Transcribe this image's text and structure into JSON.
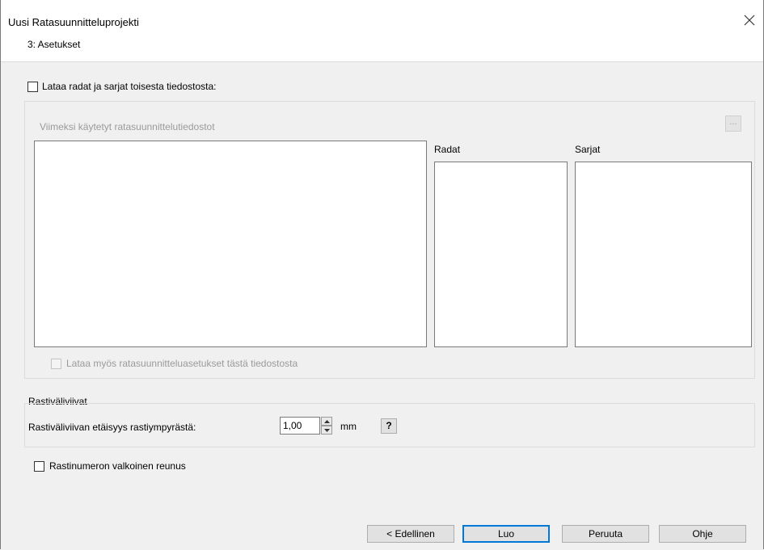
{
  "window": {
    "title": "Uusi Ratasuunnitteluprojekti",
    "step": "3: Asetukset",
    "close_glyph": "✕"
  },
  "load_from_file": {
    "label": "Lataa radat ja sarjat toisesta tiedostosta:",
    "checked": false
  },
  "recent_files": {
    "label": "Viimeksi käytetyt ratasuunnittelutiedostot",
    "browse_label": "..."
  },
  "courses": {
    "label": "Radat"
  },
  "categories": {
    "label": "Sarjat"
  },
  "load_settings": {
    "label": "Lataa myös ratasuunnitteluasetukset tästä tiedostosta",
    "checked": false,
    "enabled": false
  },
  "leg_lines": {
    "group_label": "Rastiväliviivat",
    "distance_label": "Rastiväliviivan etäisyys rastiympyrästä:",
    "distance_value": "1,00",
    "unit": "mm",
    "help_label": "?"
  },
  "white_outline": {
    "label": "Rastinumeron valkoinen reunus",
    "checked": false
  },
  "buttons": {
    "back": "< Edellinen",
    "create": "Luo",
    "cancel": "Peruuta",
    "help": "Ohje"
  },
  "colors": {
    "focus_border": "#0078d7",
    "dialog_bg": "#f0f0f0",
    "disabled_text": "#9a9a9a"
  }
}
